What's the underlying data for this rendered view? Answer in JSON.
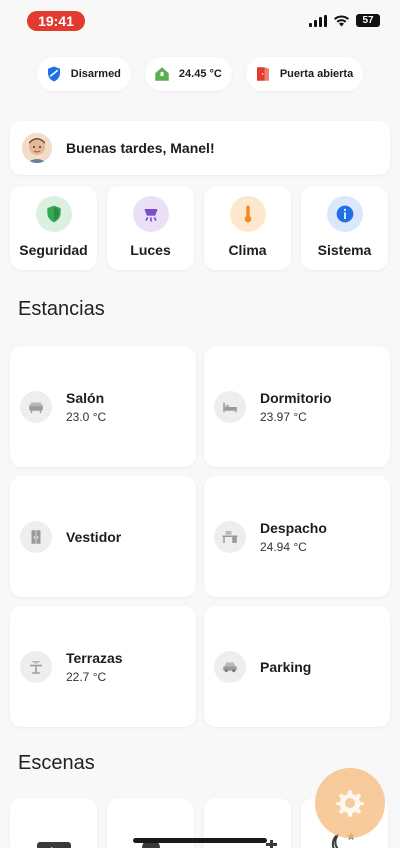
{
  "status_bar": {
    "time": "19:41",
    "battery": "57"
  },
  "chips": [
    {
      "label": "Disarmed",
      "icon": "shield-icon",
      "color": "#1e6fe8"
    },
    {
      "label": "24.45 °C",
      "icon": "home-temperature-icon",
      "color": "#5ab04e"
    },
    {
      "label": "Puerta abierta",
      "icon": "door-open-icon",
      "color": "#e23a2e"
    }
  ],
  "greeting": "Buenas tardes, Manel!",
  "categories": [
    {
      "label": "Seguridad",
      "icon": "shield-check-icon",
      "color": "#34a853",
      "bg": "#dbf0df"
    },
    {
      "label": "Luces",
      "icon": "ceiling-light-icon",
      "color": "#7d4ccc",
      "bg": "#ebe1f7"
    },
    {
      "label": "Clima",
      "icon": "thermometer-icon",
      "color": "#f08a1c",
      "bg": "#fde8cf"
    },
    {
      "label": "Sistema",
      "icon": "info-icon",
      "color": "#1e6fe8",
      "bg": "#dbe8fb"
    }
  ],
  "rooms_title": "Estancias",
  "rooms": [
    {
      "name": "Salón",
      "temp": "23.0 °C",
      "icon": "sofa-icon"
    },
    {
      "name": "Dormitorio",
      "temp": "23.97 °C",
      "icon": "bed-icon"
    },
    {
      "name": "Vestidor",
      "temp": "",
      "icon": "wardrobe-icon"
    },
    {
      "name": "Despacho",
      "temp": "24.94 °C",
      "icon": "desk-icon"
    },
    {
      "name": "Terrazas",
      "temp": "22.7 °C",
      "icon": "table-chair-icon"
    },
    {
      "name": "Parking",
      "temp": "",
      "icon": "car-icon"
    }
  ],
  "scenes_title": "Escenas",
  "scenes": [
    {
      "icon": "play-icon"
    },
    {
      "icon": "shower-icon"
    },
    {
      "icon": "faucet-icon"
    },
    {
      "icon": "moon-stars-icon"
    }
  ],
  "fab": {
    "icon": "gear-icon"
  }
}
